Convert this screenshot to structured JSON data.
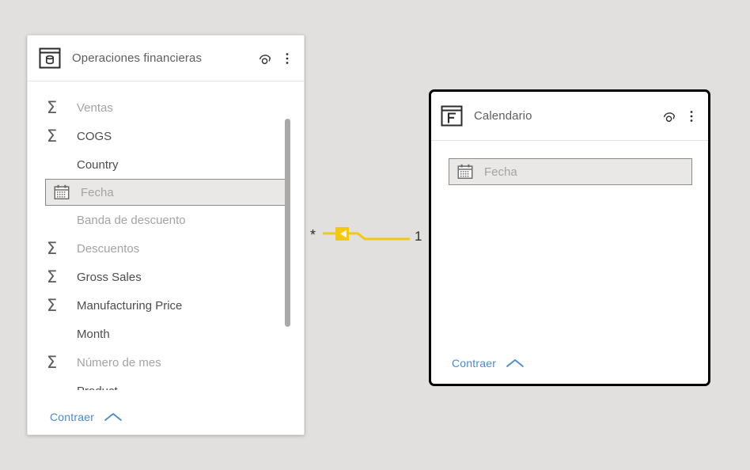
{
  "canvas": {
    "background_color": "#e1e0de",
    "accent_link_color": "#4a8ad4",
    "relationship_color": "#f2c811"
  },
  "tables": [
    {
      "id": "operaciones-financieras",
      "name": "Operaciones financieras",
      "icon": "table-database-icon",
      "selected": false,
      "header_actions": [
        {
          "name": "expand-collapse-icon",
          "label": "Expandir"
        },
        {
          "name": "more-options-icon",
          "label": "Más opciones"
        }
      ],
      "footer": {
        "label": "Contraer",
        "icon": "chevron-up-icon"
      },
      "fields": [
        {
          "label": "Ventas",
          "icon": "sigma-icon",
          "tone": "dim",
          "highlighted": false
        },
        {
          "label": "COGS",
          "icon": "sigma-icon",
          "tone": "dark",
          "highlighted": false
        },
        {
          "label": "Country",
          "icon": "none",
          "tone": "dark",
          "highlighted": false
        },
        {
          "label": "Fecha",
          "icon": "calendar-icon",
          "tone": "dim",
          "highlighted": true
        },
        {
          "label": "Banda de descuento",
          "icon": "none",
          "tone": "dim",
          "highlighted": false
        },
        {
          "label": "Descuentos",
          "icon": "sigma-icon",
          "tone": "dim",
          "highlighted": false
        },
        {
          "label": "Gross Sales",
          "icon": "sigma-icon",
          "tone": "dark",
          "highlighted": false
        },
        {
          "label": "Manufacturing Price",
          "icon": "sigma-icon",
          "tone": "dark",
          "highlighted": false
        },
        {
          "label": "Month",
          "icon": "none",
          "tone": "dark",
          "highlighted": false
        },
        {
          "label": "Número de mes",
          "icon": "sigma-icon",
          "tone": "dim",
          "highlighted": false
        },
        {
          "label": "Product",
          "icon": "none",
          "tone": "dark",
          "highlighted": false
        }
      ]
    },
    {
      "id": "calendario",
      "name": "Calendario",
      "icon": "table-date-icon",
      "selected": true,
      "header_actions": [
        {
          "name": "expand-collapse-icon",
          "label": "Expandir"
        },
        {
          "name": "more-options-icon",
          "label": "Más opciones"
        }
      ],
      "footer": {
        "label": "Contraer",
        "icon": "chevron-up-icon"
      },
      "fields": [
        {
          "label": "Fecha",
          "icon": "calendar-icon",
          "tone": "dim",
          "highlighted": true
        }
      ]
    }
  ],
  "relationship": {
    "from_cardinality": "*",
    "to_cardinality": "1",
    "cross_filter_direction": "single",
    "arrow_icon": "cross-filter-arrow-icon"
  }
}
